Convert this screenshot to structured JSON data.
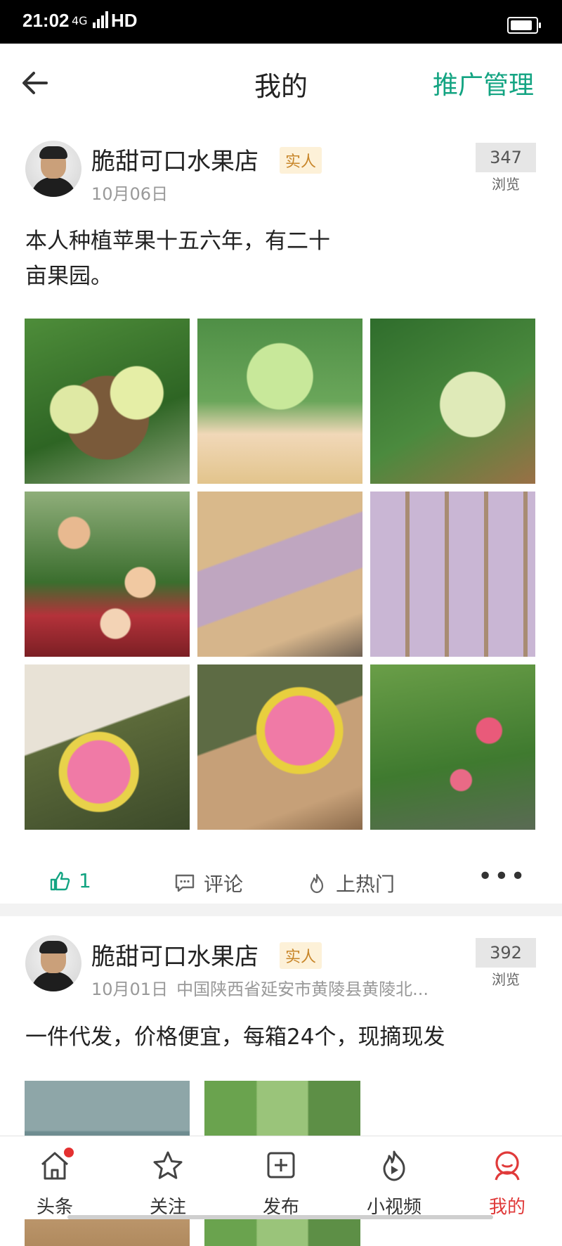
{
  "status_bar": {
    "time": "21:02",
    "network": "4G",
    "hd": "HD"
  },
  "header": {
    "title": "我的",
    "action": "推广管理"
  },
  "posts": [
    {
      "user": "脆甜可口水果店",
      "badge": "实人",
      "date": "10月06日",
      "location": "",
      "views": "347",
      "views_label": "浏览",
      "text_lines": [
        "本人种植苹果十五六年，有二十",
        "亩果园。"
      ],
      "likes": "1",
      "comment_label": "评论",
      "hot_label": "上热门",
      "more": "•••"
    },
    {
      "user": "脆甜可口水果店",
      "badge": "实人",
      "date": "10月01日",
      "location": "中国陕西省延安市黄陵县黄陵北...",
      "views": "392",
      "views_label": "浏览",
      "text_lines": [
        "一件代发，价格便宜，每箱24个，现摘现发"
      ]
    }
  ],
  "tabbar": [
    {
      "label": "头条",
      "icon": "home-icon"
    },
    {
      "label": "关注",
      "icon": "star-icon"
    },
    {
      "label": "发布",
      "icon": "plus-square-icon"
    },
    {
      "label": "小视频",
      "icon": "flame-play-icon"
    },
    {
      "label": "我的",
      "icon": "user-icon"
    }
  ],
  "colors": {
    "accent": "#13a482",
    "active_tab": "#e03a3a",
    "badge_bg": "#fdf1d8"
  }
}
